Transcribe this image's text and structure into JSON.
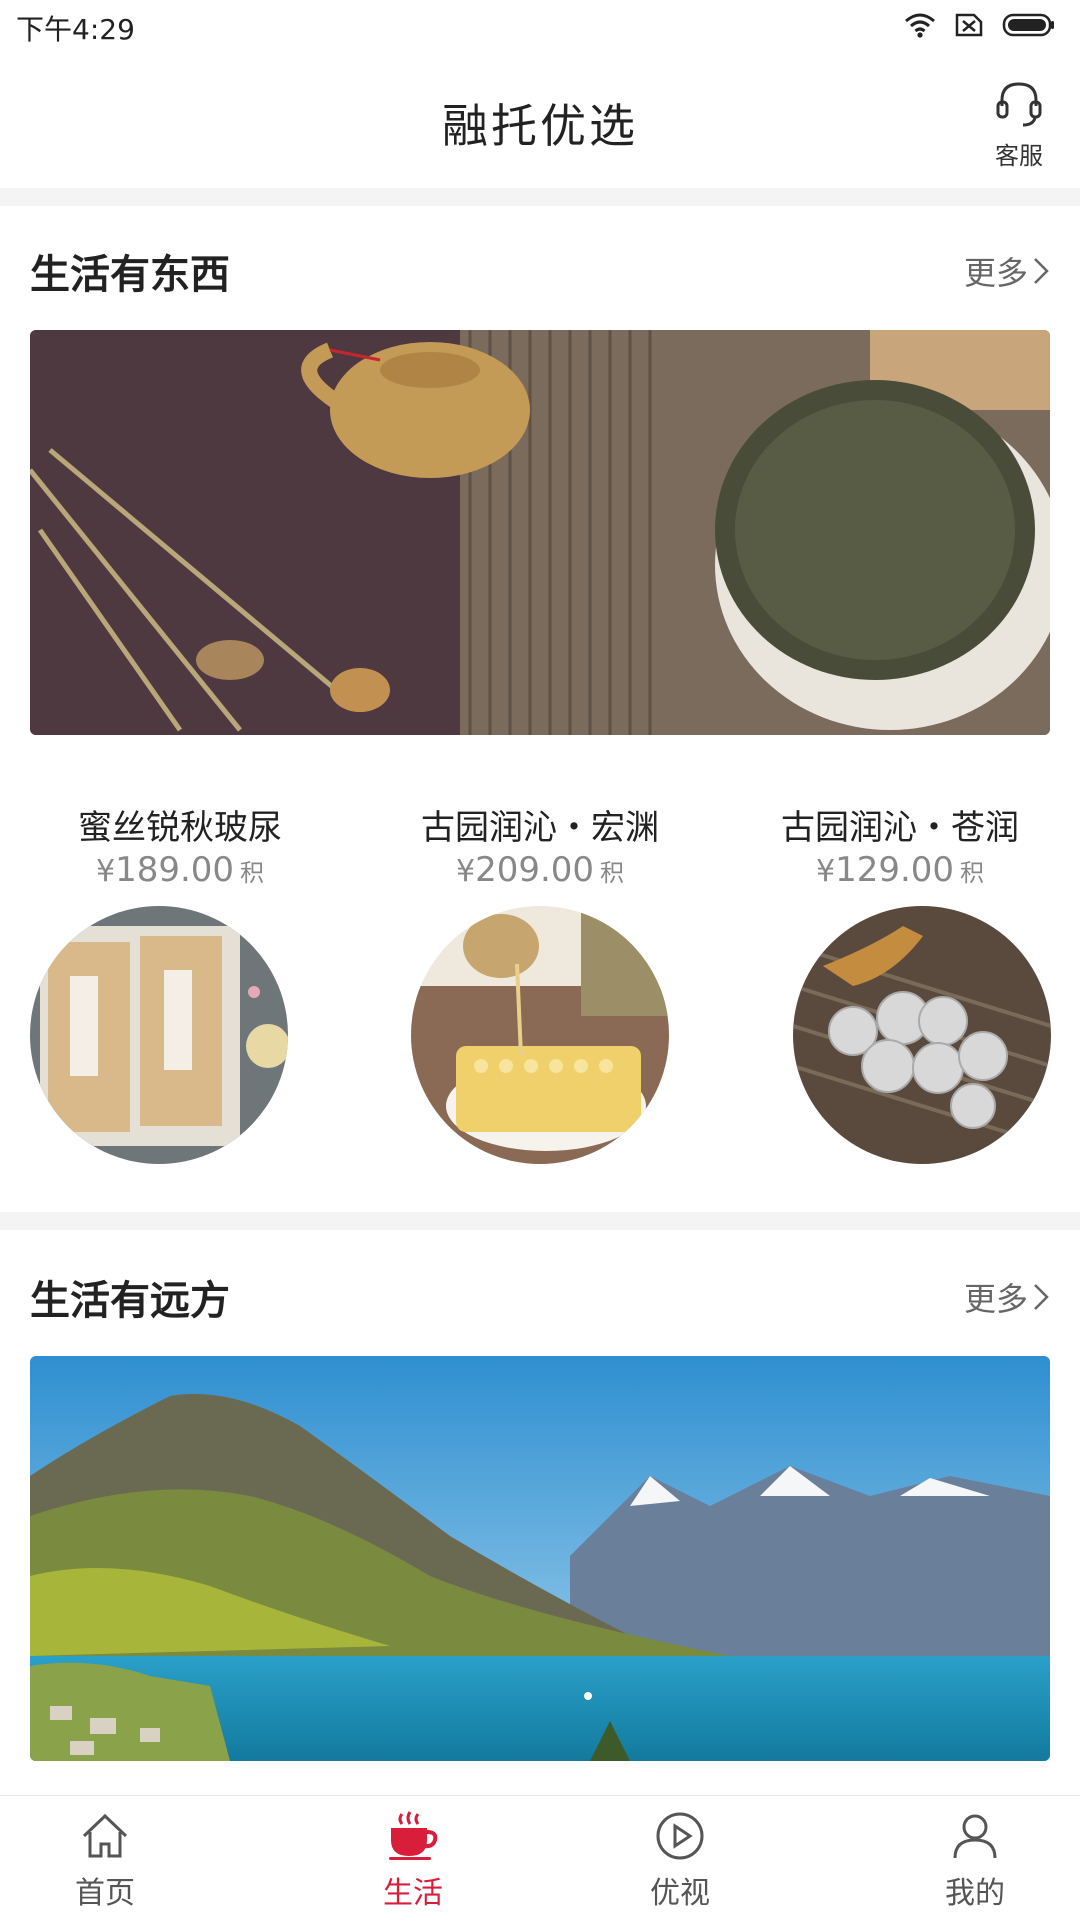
{
  "status_bar": {
    "time": "下午4:29"
  },
  "header": {
    "title": "融托优选",
    "service_label": "客服"
  },
  "sections": [
    {
      "title": "生活有东西",
      "more_label": "更多",
      "banner_desc": "tea"
    },
    {
      "title": "生活有远方",
      "more_label": "更多",
      "banner_desc": "lake"
    }
  ],
  "products": [
    {
      "name": "蜜丝锐秋玻尿",
      "currency": "¥",
      "price": "189.00",
      "unit": "积"
    },
    {
      "name": "古园润沁・宏渊",
      "currency": "¥",
      "price": "209.00",
      "unit": "积"
    },
    {
      "name": "古园润沁・苍润",
      "currency": "¥",
      "price": "129.00",
      "unit": "积"
    }
  ],
  "tabs": [
    {
      "label": "首页",
      "icon": "home-icon",
      "active": false
    },
    {
      "label": "生活",
      "icon": "coffee-cup-icon",
      "active": true
    },
    {
      "label": "优视",
      "icon": "play-icon",
      "active": false
    },
    {
      "label": "我的",
      "icon": "user-icon",
      "active": false
    }
  ],
  "colors": {
    "accent": "#d81e3a",
    "divider": "#f4f4f4"
  }
}
